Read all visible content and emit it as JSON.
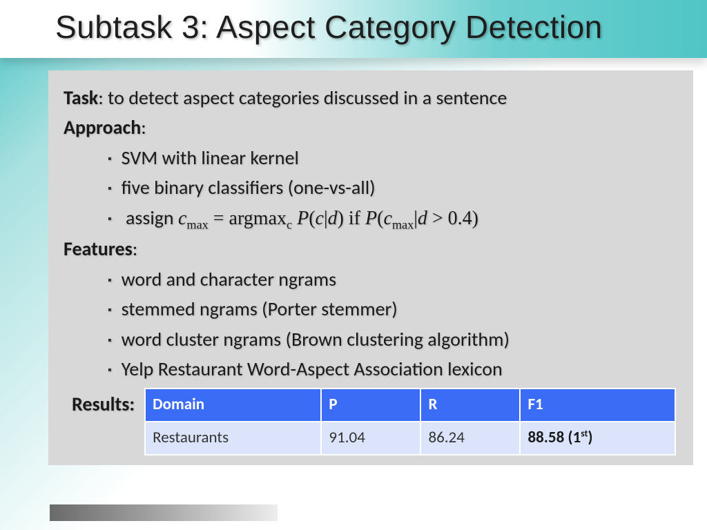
{
  "title": "Subtask 3: Aspect Category Detection",
  "task": {
    "label": "Task",
    "text": ": to detect aspect categories discussed in a sentence"
  },
  "approach": {
    "label": "Approach",
    "items": [
      "SVM with linear kernel",
      "five binary classifiers (one-vs-all)"
    ],
    "assign_prefix": "assign "
  },
  "features": {
    "label": "Features",
    "items": [
      "word and character ngrams",
      "stemmed ngrams (Porter stemmer)",
      "word cluster ngrams (Brown clustering algorithm)",
      "Yelp Restaurant Word-Aspect Association lexicon"
    ]
  },
  "results": {
    "label": "Results",
    "headers": [
      "Domain",
      "P",
      "R",
      "F1"
    ],
    "row": {
      "domain": "Restaurants",
      "p": "91.04",
      "r": "86.24",
      "f1_value": "88.58 (1",
      "f1_sup": "st",
      "f1_close": ")"
    }
  },
  "chart_data": {
    "type": "table",
    "title": "Results",
    "columns": [
      "Domain",
      "P",
      "R",
      "F1"
    ],
    "rows": [
      {
        "Domain": "Restaurants",
        "P": 91.04,
        "R": 86.24,
        "F1": "88.58 (1st)"
      }
    ]
  }
}
